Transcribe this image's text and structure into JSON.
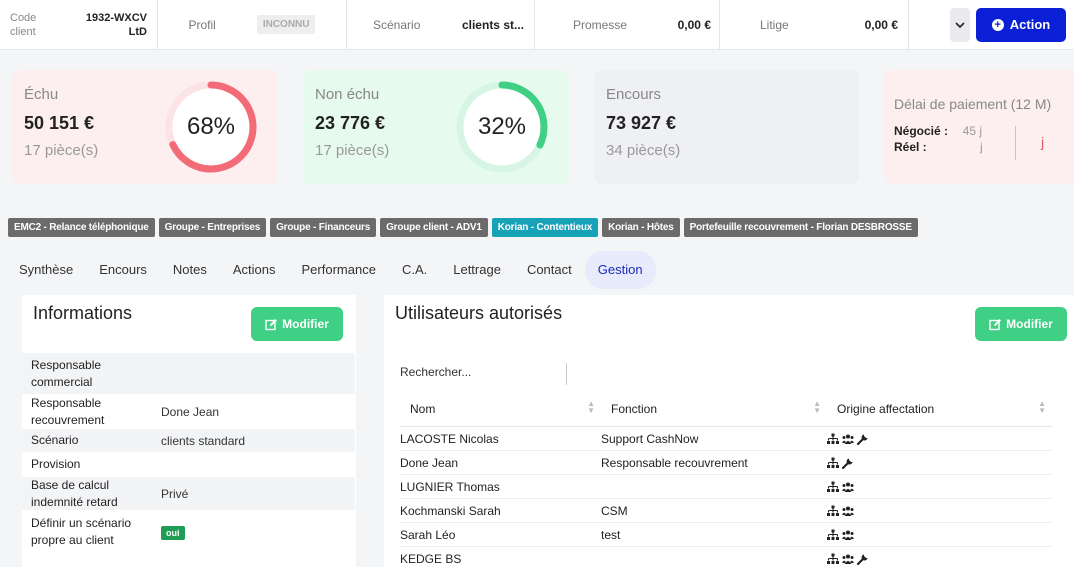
{
  "topbar": {
    "code_label": "Code client",
    "code_value": "1932-WXCV LtD",
    "profil_label": "Profil",
    "profil_badge": "INCONNU",
    "scenario_label": "Scénario",
    "scenario_value": "clients st...",
    "promesse_label": "Promesse",
    "promesse_value": "0,00 €",
    "litige_label": "Litige",
    "litige_value": "0,00 €",
    "action_label": "Action"
  },
  "kpis": {
    "echu": {
      "title": "Échu",
      "amount": "50 151 €",
      "pieces": "17 pièce(s)",
      "percent_label": "68%",
      "percent": 68,
      "color": "#f26b76"
    },
    "non_echu": {
      "title": "Non échu",
      "amount": "23 776 €",
      "pieces": "17 pièce(s)",
      "percent_label": "32%",
      "percent": 32,
      "color": "#3fcf85"
    },
    "encours": {
      "title": "Encours",
      "amount": "73 927 €",
      "pieces": "34 pièce(s)"
    },
    "delai": {
      "title": "Délai de paiement (12 M)",
      "negocie_label": "Négocié :",
      "negocie_value": "45 j",
      "reel_label": "Réel :",
      "reel_value": "j",
      "j_value": "j"
    }
  },
  "tags": [
    "EMC2 - Relance téléphonique",
    "Groupe - Entreprises",
    "Groupe - Financeurs",
    "Groupe client - ADV1",
    "Korian - Contentieux",
    "Korian - Hôtes",
    "Portefeuille recouvrement - Florian DESBROSSE"
  ],
  "tabs": [
    "Synthèse",
    "Encours",
    "Notes",
    "Actions",
    "Performance",
    "C.A.",
    "Lettrage",
    "Contact",
    "Gestion"
  ],
  "informations": {
    "title": "Informations",
    "modify_label": "Modifier",
    "rows": [
      {
        "label": "Responsable commercial",
        "value": ""
      },
      {
        "label": "Responsable recouvrement",
        "value": "Done Jean"
      },
      {
        "label": "Scénario",
        "value": "clients standard"
      },
      {
        "label": "Provision",
        "value": ""
      },
      {
        "label": "Base de calcul indemnité retard",
        "value": "Privé"
      },
      {
        "label": "Définir un scénario propre au client",
        "value": "oui"
      }
    ]
  },
  "users": {
    "title": "Utilisateurs autorisés",
    "modify_label": "Modifier",
    "search_placeholder": "Rechercher...",
    "columns": [
      "Nom",
      "Fonction",
      "Origine affectation"
    ],
    "rows": [
      {
        "nom": "LACOSTE Nicolas",
        "fonction": "Support CashNow",
        "icons": [
          "hierarchy-icon",
          "group-icon",
          "wrench-icon"
        ]
      },
      {
        "nom": "Done Jean",
        "fonction": "Responsable recouvrement",
        "icons": [
          "hierarchy-icon",
          "wrench-icon"
        ]
      },
      {
        "nom": "LUGNIER Thomas",
        "fonction": "",
        "icons": [
          "hierarchy-icon",
          "group-icon"
        ]
      },
      {
        "nom": "Kochmanski Sarah",
        "fonction": "CSM",
        "icons": [
          "hierarchy-icon",
          "group-icon"
        ]
      },
      {
        "nom": "Sarah Léo",
        "fonction": "test",
        "icons": [
          "hierarchy-icon",
          "group-icon"
        ]
      },
      {
        "nom": "KEDGE BS",
        "fonction": "",
        "icons": [
          "hierarchy-icon",
          "group-icon",
          "wrench-icon"
        ]
      }
    ]
  }
}
